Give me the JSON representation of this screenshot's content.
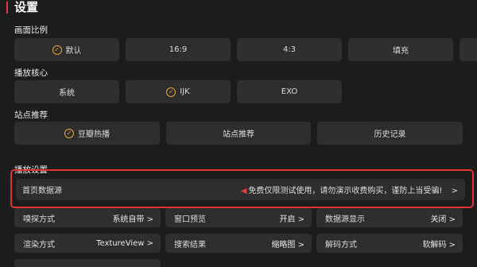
{
  "header": {
    "title": "设置",
    "accent_color": "#e23b3b"
  },
  "aspect_ratio": {
    "label": "画面比例",
    "options": [
      "默认",
      "16:9",
      "4:3",
      "填充"
    ],
    "selected": "默认"
  },
  "player_core": {
    "label": "播放核心",
    "options": [
      "系统",
      "IJK",
      "EXO"
    ],
    "selected": "IJK"
  },
  "site_recommend": {
    "label": "站点推荐",
    "options": [
      "豆瓣热播",
      "站点推荐",
      "历史记录"
    ],
    "selected": "豆瓣热播"
  },
  "playback_settings": {
    "label": "播放设置",
    "home_source": {
      "label": "首页数据源",
      "notice": "免费仅限测试使用，请勿演示收费购买，谨防上当受骗!",
      "arrow": ">"
    },
    "rows": [
      [
        {
          "label": "嗅探方式",
          "value": "系统自带 >"
        },
        {
          "label": "窗口预览",
          "value": "开启 >"
        },
        {
          "label": "数据源显示",
          "value": "关闭 >"
        }
      ],
      [
        {
          "label": "渲染方式",
          "value": "TextureView >"
        },
        {
          "label": "搜索结果",
          "value": "缩略图 >"
        },
        {
          "label": "解码方式",
          "value": "软解码 >"
        }
      ]
    ]
  },
  "colors": {
    "check": "#e9a33a",
    "highlight_border": "#e0302f",
    "button_bg": "#2e2e2e",
    "background": "#1c1c1c"
  }
}
